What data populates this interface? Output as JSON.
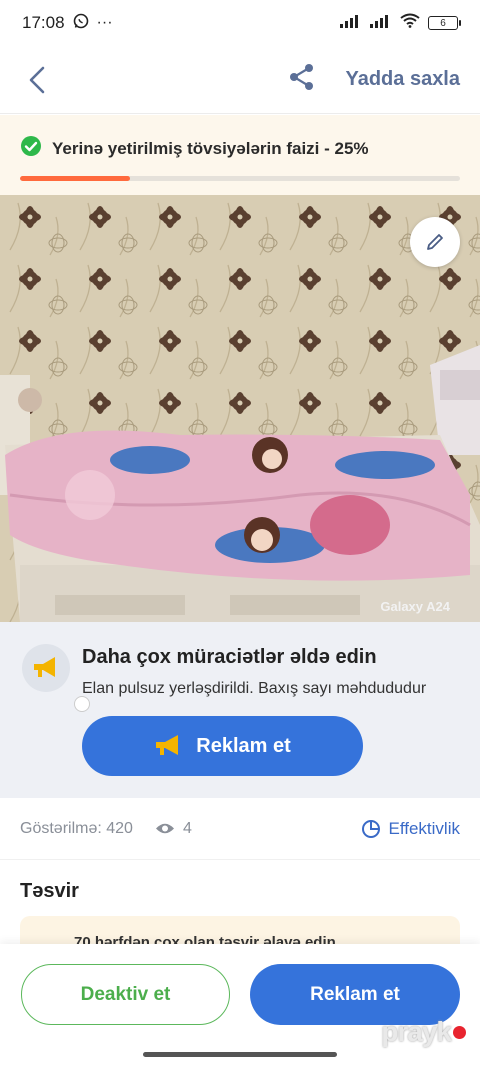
{
  "status_bar": {
    "time": "17:08",
    "battery": "6"
  },
  "header": {
    "save_label": "Yadda saxla"
  },
  "progress": {
    "text": "Yerinə yetirilmiş tövsiyələrin faizi - 25%",
    "percent": 25,
    "fill_color": "#ff6a3d"
  },
  "photo": {
    "camera_tag": "Galaxy A24"
  },
  "promo": {
    "title": "Daha çox müraciətlər əldə edin",
    "subtitle": "Elan pulsuz yerləşdirildi. Baxış sayı məhdududur",
    "button_label": "Reklam et"
  },
  "stats": {
    "impressions": "Göstərilmə: 420",
    "views": "4",
    "effectiveness_label": "Effektivlik"
  },
  "description": {
    "title": "Təsvir",
    "hint": "70 hərfdən çox olan təsvir əlavə edin"
  },
  "bottom": {
    "deactivate_label": "Deaktiv et",
    "reklam_label": "Reklam et",
    "watermark": "prayk"
  },
  "colors": {
    "primary": "#3573db",
    "success": "#4cae4c",
    "accent": "#ff6a3d"
  }
}
